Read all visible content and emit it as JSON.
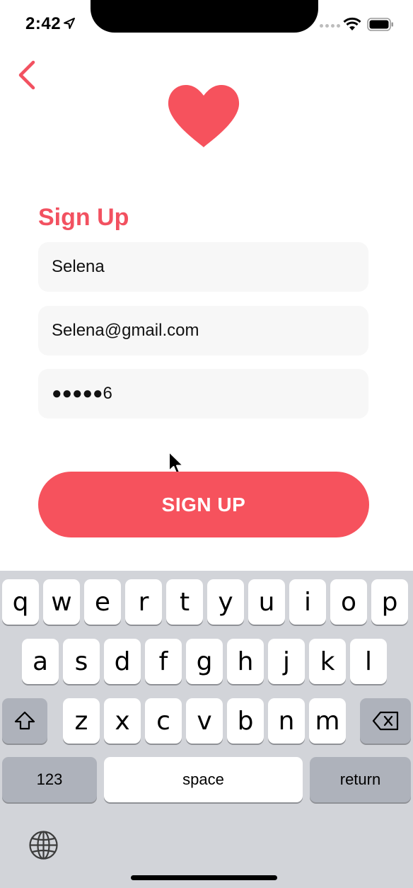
{
  "status_bar": {
    "time": "2:42",
    "icons": [
      "location-arrow-icon",
      "signal-icon",
      "wifi-icon",
      "battery-icon"
    ]
  },
  "header": {
    "back_icon": "chevron-left-icon",
    "logo_icon": "heart-icon"
  },
  "form": {
    "title": "Sign Up",
    "name_value": "Selena",
    "email_value": "Selena@gmail.com",
    "password_value": "●●●●●6",
    "submit_label": "SIGN UP"
  },
  "keyboard": {
    "row1": [
      "q",
      "w",
      "e",
      "r",
      "t",
      "y",
      "u",
      "i",
      "o",
      "p"
    ],
    "row2": [
      "a",
      "s",
      "d",
      "f",
      "g",
      "h",
      "j",
      "k",
      "l"
    ],
    "row3": [
      "z",
      "x",
      "c",
      "v",
      "b",
      "n",
      "m"
    ],
    "numbers_label": "123",
    "space_label": "space",
    "return_label": "return"
  },
  "colors": {
    "accent": "#f6525d",
    "field_bg": "#f7f7f7",
    "keyboard_bg": "#d2d4d9"
  }
}
